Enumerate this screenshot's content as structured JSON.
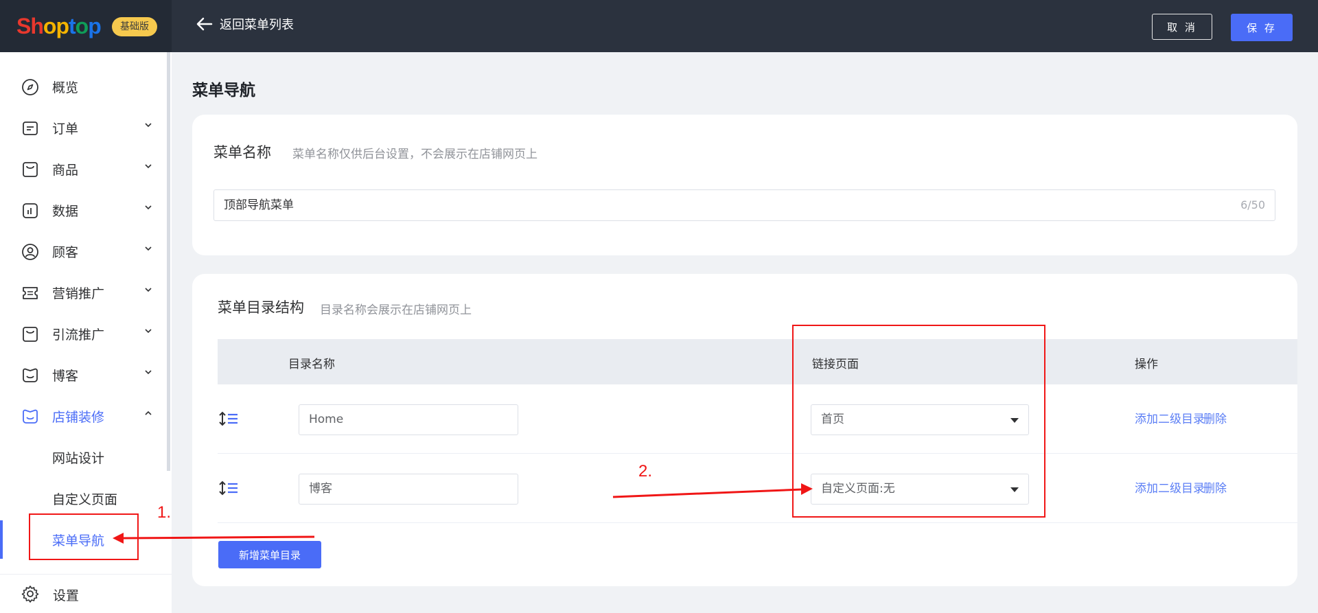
{
  "brand": {
    "logo_letters": [
      "S",
      "h",
      "o",
      "p",
      "t",
      "o",
      "p"
    ],
    "logo_colors": [
      "#e8382d",
      "#e8382d",
      "#f4b400",
      "#f4b400",
      "#1a73e8",
      "#0f9d58",
      "#1a73e8"
    ],
    "edition_badge": "基础版"
  },
  "header": {
    "back_label": "返回菜单列表",
    "cancel_label": "取 消",
    "save_label": "保 存"
  },
  "sidebar": {
    "items": [
      {
        "label": "概览",
        "icon": "compass-icon"
      },
      {
        "label": "订单",
        "icon": "order-icon"
      },
      {
        "label": "商品",
        "icon": "bag-icon"
      },
      {
        "label": "数据",
        "icon": "chart-icon"
      },
      {
        "label": "顾客",
        "icon": "user-icon"
      },
      {
        "label": "营销推广",
        "icon": "ticket-icon"
      },
      {
        "label": "引流推广",
        "icon": "bag-icon"
      },
      {
        "label": "博客",
        "icon": "smile-icon"
      },
      {
        "label": "店铺装修",
        "icon": "store-icon"
      }
    ],
    "sub_items": [
      "网站设计",
      "自定义页面",
      "菜单导航"
    ],
    "settings_label": "设置"
  },
  "page": {
    "title": "菜单导航",
    "menu_name": {
      "title": "菜单名称",
      "hint": "菜单名称仅供后台设置，不会展示在店铺网页上",
      "value": "顶部导航菜单",
      "counter": "6/50"
    },
    "structure": {
      "title": "菜单目录结构",
      "hint": "目录名称会展示在店铺网页上",
      "columns": [
        "目录名称",
        "链接页面",
        "操作"
      ],
      "rows": [
        {
          "name": "Home",
          "link": "首页",
          "add_sub": "添加二级目录",
          "delete": "删除"
        },
        {
          "name": "博客",
          "link": "自定义页面:无",
          "add_sub": "添加二级目录",
          "delete": "删除"
        }
      ],
      "add_button": "新增菜单目录"
    }
  },
  "annotations": {
    "step1": "1.",
    "step2": "2.",
    "color": "#f01616"
  },
  "colors": {
    "accent": "#4a6cf7",
    "topbar": "#2b323e",
    "link": "#5b7ef5",
    "badge": "#f6c94e"
  }
}
